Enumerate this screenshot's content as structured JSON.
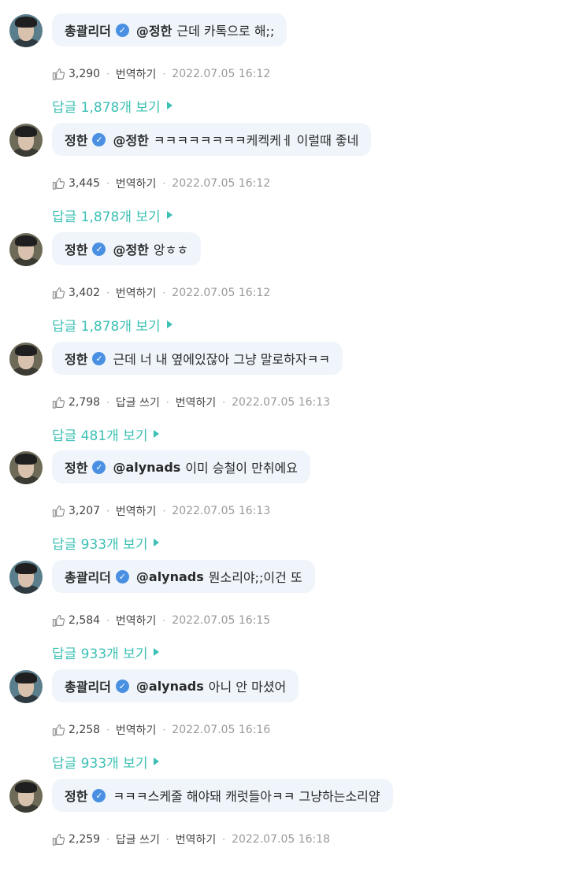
{
  "comments": [
    {
      "author": "총괄리더",
      "avatar": "leader",
      "mention": "@정한",
      "text": "근데 카톡으로 해;;",
      "likes": "3,290",
      "actions": [
        "번역하기"
      ],
      "date": "2022.07.05 16:12",
      "replies": "답글 1,878개 보기"
    },
    {
      "author": "정한",
      "avatar": "jh",
      "mention": "@정한",
      "text": "ㅋㅋㅋㅋㅋㅋㅋㅋ케켁케ㅔ 이럴때 좋네",
      "likes": "3,445",
      "actions": [
        "번역하기"
      ],
      "date": "2022.07.05 16:12",
      "replies": "답글 1,878개 보기"
    },
    {
      "author": "정한",
      "avatar": "jh",
      "mention": "@정한",
      "text": "앙ㅎㅎ",
      "likes": "3,402",
      "actions": [
        "번역하기"
      ],
      "date": "2022.07.05 16:12",
      "replies": "답글 1,878개 보기"
    },
    {
      "author": "정한",
      "avatar": "jh",
      "mention": "",
      "text": "근데 너 내 옆에있잖아 그냥 말로하자ㅋㅋ",
      "likes": "2,798",
      "actions": [
        "답글 쓰기",
        "번역하기"
      ],
      "date": "2022.07.05 16:13",
      "replies": "답글 481개 보기"
    },
    {
      "author": "정한",
      "avatar": "jh",
      "mention": "@alynads",
      "text": "이미 승철이 만취에요",
      "likes": "3,207",
      "actions": [
        "번역하기"
      ],
      "date": "2022.07.05 16:13",
      "replies": "답글 933개 보기"
    },
    {
      "author": "총괄리더",
      "avatar": "leader",
      "mention": "@alynads",
      "text": "뭔소리야;;이건 또",
      "likes": "2,584",
      "actions": [
        "번역하기"
      ],
      "date": "2022.07.05 16:15",
      "replies": "답글 933개 보기"
    },
    {
      "author": "총괄리더",
      "avatar": "leader",
      "mention": "@alynads",
      "text": "아니 안 마셨어",
      "likes": "2,258",
      "actions": [
        "번역하기"
      ],
      "date": "2022.07.05 16:16",
      "replies": "답글 933개 보기"
    },
    {
      "author": "정한",
      "avatar": "jh",
      "mention": "",
      "text": "ㅋㅋㅋ스케줄 해야돼 캐럿들아ㅋㅋ 그냥하는소리얌",
      "likes": "2,259",
      "actions": [
        "답글 쓰기",
        "번역하기"
      ],
      "date": "2022.07.05 16:18",
      "replies": ""
    }
  ],
  "icons": {
    "like": "thumbs-up-icon",
    "verified": "verified-check-icon",
    "replies": "triangle-right-icon"
  },
  "colors": {
    "bubble": "#eff5fb",
    "replies_link": "#3cc0b4",
    "verified": "#4a90e2",
    "date": "#9a9a9a"
  }
}
